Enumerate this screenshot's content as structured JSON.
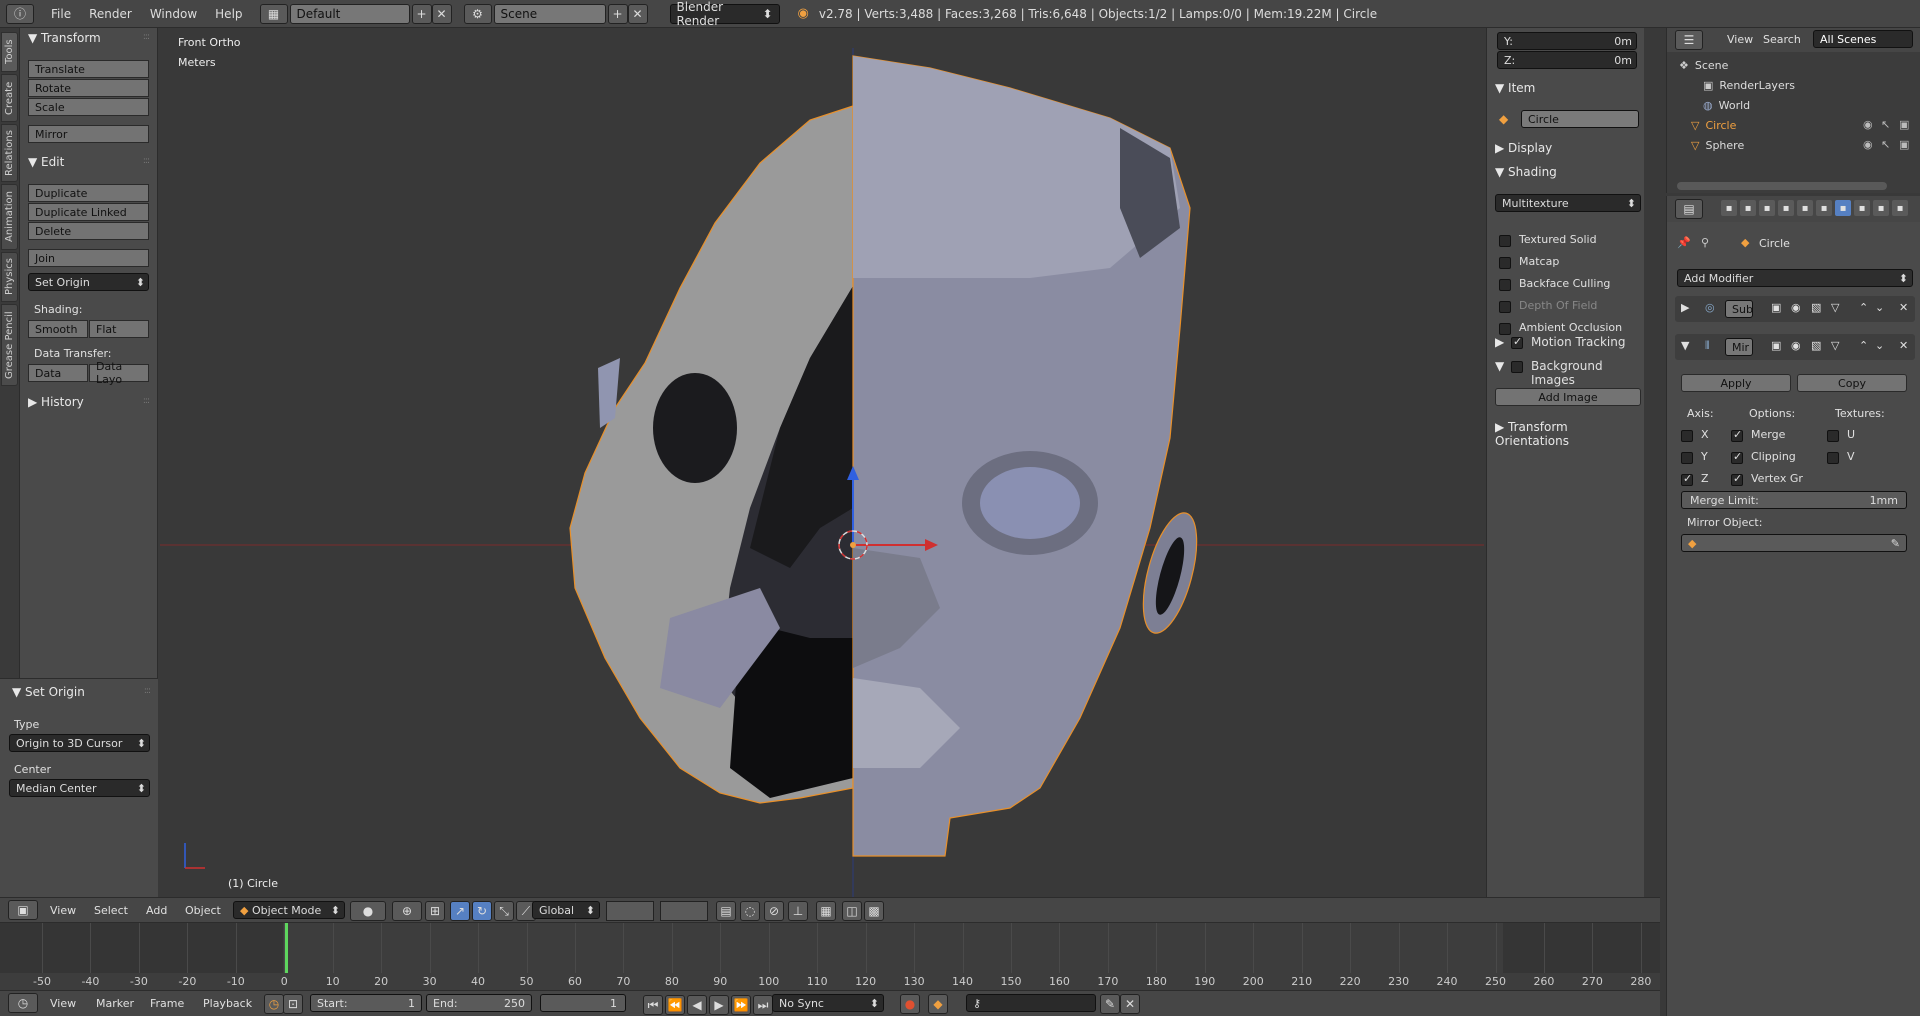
{
  "topbar": {
    "menus": [
      "File",
      "Render",
      "Window",
      "Help"
    ],
    "layout": "Default",
    "scene": "Scene",
    "engine": "Blender Render",
    "stats": "v2.78 | Verts:3,488 | Faces:3,268 | Tris:6,648 | Objects:1/2 | Lamps:0/0 | Mem:19.22M | Circle"
  },
  "toolshelf": {
    "tabs": [
      "Tools",
      "Create",
      "Relations",
      "Animation",
      "Physics",
      "Grease Pencil"
    ],
    "transform": {
      "title": "Transform",
      "buttons": [
        "Translate",
        "Rotate",
        "Scale",
        "Mirror"
      ]
    },
    "edit": {
      "title": "Edit",
      "buttons": [
        "Duplicate",
        "Duplicate Linked",
        "Delete",
        "Join"
      ],
      "set_origin": "Set Origin",
      "shading_label": "Shading:",
      "smooth": "Smooth",
      "flat": "Flat",
      "data_transfer_label": "Data Transfer:",
      "data": "Data",
      "data_layout": "Data Layo"
    },
    "history": "History"
  },
  "operator": {
    "title": "Set Origin",
    "type_label": "Type",
    "type_value": "Origin to 3D Cursor",
    "center_label": "Center",
    "center_value": "Median Center"
  },
  "viewport": {
    "view_name": "Front Ortho",
    "units": "Meters",
    "object_label": "(1) Circle"
  },
  "view_header": {
    "menus": [
      "View",
      "Select",
      "Add",
      "Object"
    ],
    "mode": "Object Mode",
    "orientation": "Global"
  },
  "npanel": {
    "y_label": "Y:",
    "y_value": "0m",
    "z_label": "Z:",
    "z_value": "0m",
    "item_title": "Item",
    "item_name": "Circle",
    "display_title": "Display",
    "shading_title": "Shading",
    "shading_mode": "Multitexture",
    "options": [
      {
        "label": "Textured Solid",
        "checked": false,
        "disabled": false
      },
      {
        "label": "Matcap",
        "checked": false,
        "disabled": false
      },
      {
        "label": "Backface Culling",
        "checked": false,
        "disabled": false
      },
      {
        "label": "Depth Of Field",
        "checked": false,
        "disabled": true
      },
      {
        "label": "Ambient Occlusion",
        "checked": false,
        "disabled": false
      }
    ],
    "motion_tracking": "Motion Tracking",
    "background_images": "Background Images",
    "add_image": "Add Image",
    "transform_orientations": "Transform Orientations"
  },
  "outliner": {
    "menus": [
      "View",
      "Search"
    ],
    "filter": "All Scenes",
    "items": [
      "Scene",
      "RenderLayers",
      "World",
      "Circle",
      "Sphere"
    ]
  },
  "properties": {
    "object_name": "Circle",
    "add_modifier": "Add Modifier",
    "mod1": "Sub",
    "mod2": "Mir",
    "apply": "Apply",
    "copy": "Copy",
    "axis_label": "Axis:",
    "options_label": "Options:",
    "textures_label": "Textures:",
    "axes": [
      {
        "label": "X",
        "checked": false
      },
      {
        "label": "Y",
        "checked": false
      },
      {
        "label": "Z",
        "checked": true
      }
    ],
    "opts": [
      {
        "label": "Merge",
        "checked": true
      },
      {
        "label": "Clipping",
        "checked": true
      },
      {
        "label": "Vertex Gr",
        "checked": true
      }
    ],
    "texs": [
      {
        "label": "U",
        "checked": false
      },
      {
        "label": "V",
        "checked": false
      }
    ],
    "merge_limit_label": "Merge Limit:",
    "merge_limit_value": "1mm",
    "mirror_object_label": "Mirror Object:"
  },
  "timeline": {
    "ticks": [
      "-50",
      "-40",
      "-30",
      "-20",
      "-10",
      "0",
      "10",
      "20",
      "30",
      "40",
      "50",
      "60",
      "70",
      "80",
      "90",
      "100",
      "110",
      "120",
      "130",
      "140",
      "150",
      "160",
      "170",
      "180",
      "190",
      "200",
      "210",
      "220",
      "230",
      "240",
      "250",
      "260",
      "270",
      "280"
    ],
    "current_frame": 1,
    "menus": [
      "View",
      "Marker",
      "Frame",
      "Playback"
    ],
    "start_label": "Start:",
    "start_value": "1",
    "end_label": "End:",
    "end_value": "250",
    "frame_value": "1",
    "sync": "No Sync"
  },
  "colors": {
    "accent_orange": "#f0a040",
    "x_axis": "#d03030",
    "z_axis": "#3060e0",
    "selection": "#5680c2"
  }
}
